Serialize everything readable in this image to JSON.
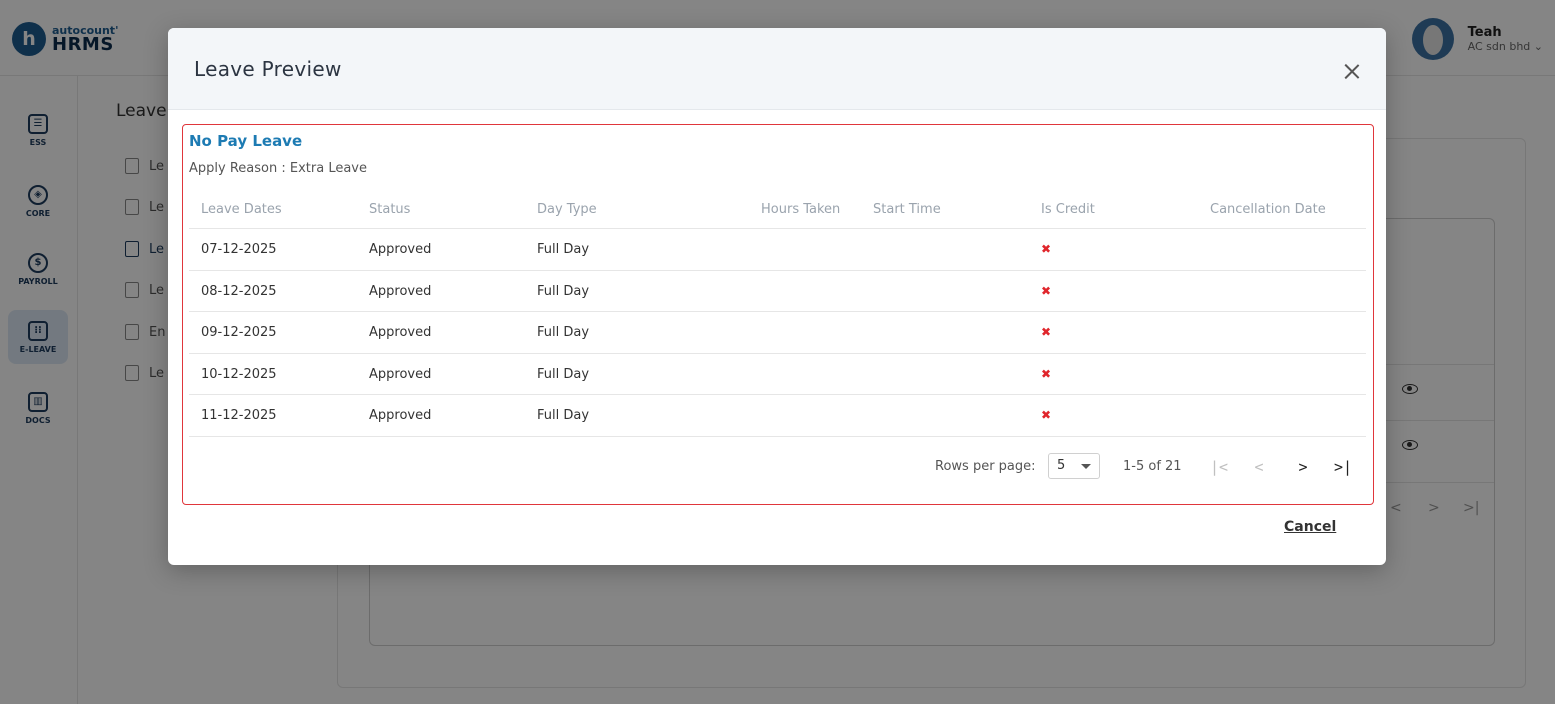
{
  "app": {
    "logo_letter": "h",
    "logo_top": "autocount'",
    "logo_bottom": "HRMS",
    "user_name": "Teah",
    "user_company": "AC sdn bhd ⌄"
  },
  "sidebar": {
    "items": [
      {
        "label": "ESS",
        "icon": "id-card-icon"
      },
      {
        "label": "CORE",
        "icon": "cube-icon"
      },
      {
        "label": "PAYROLL",
        "icon": "dollar-icon"
      },
      {
        "label": "E-LEAVE",
        "icon": "calendar-icon"
      },
      {
        "label": "DOCS",
        "icon": "document-chart-icon"
      }
    ],
    "active": "E-LEAVE"
  },
  "background": {
    "page_title": "Leave",
    "sub_items": [
      "Le",
      "Le",
      "Le",
      "Le",
      "En",
      "Le"
    ],
    "pager": {
      "prev": "<",
      "next": ">",
      "last": ">|"
    }
  },
  "modal": {
    "title": "Leave Preview",
    "leave_type": "No Pay Leave",
    "apply_reason_label": "Apply Reason :",
    "apply_reason_value": "Extra Leave",
    "columns": [
      "Leave Dates",
      "Status",
      "Day Type",
      "Hours Taken",
      "Start Time",
      "Is Credit",
      "Cancellation Date"
    ],
    "rows": [
      {
        "date": "07-12-2025",
        "status": "Approved",
        "day_type": "Full Day",
        "hours": "",
        "start": "",
        "credit": "✖",
        "cancel_date": ""
      },
      {
        "date": "08-12-2025",
        "status": "Approved",
        "day_type": "Full Day",
        "hours": "",
        "start": "",
        "credit": "✖",
        "cancel_date": ""
      },
      {
        "date": "09-12-2025",
        "status": "Approved",
        "day_type": "Full Day",
        "hours": "",
        "start": "",
        "credit": "✖",
        "cancel_date": ""
      },
      {
        "date": "10-12-2025",
        "status": "Approved",
        "day_type": "Full Day",
        "hours": "",
        "start": "",
        "credit": "✖",
        "cancel_date": ""
      },
      {
        "date": "11-12-2025",
        "status": "Approved",
        "day_type": "Full Day",
        "hours": "",
        "start": "",
        "credit": "✖",
        "cancel_date": ""
      }
    ],
    "pagination": {
      "rows_per_page_label": "Rows per page:",
      "rows_per_page_value": "5",
      "range": "1-5 of 21",
      "first": "|<",
      "prev": "<",
      "next": ">",
      "last": ">|"
    },
    "cancel_label": "Cancel"
  },
  "colors": {
    "accent": "#1d7bb3",
    "highlight_border": "#e0363b",
    "credit_cross": "#e0262c"
  }
}
